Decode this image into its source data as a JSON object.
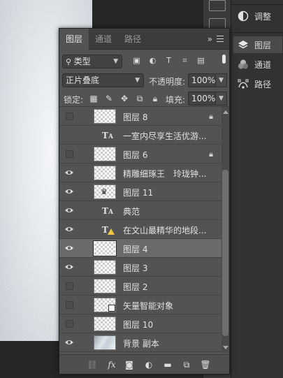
{
  "panel": {
    "tabs": [
      "图层",
      "通道",
      "路径"
    ],
    "more": "»"
  },
  "filter": {
    "kind_label": "类型"
  },
  "blend": {
    "mode": "正片叠底",
    "opacity_label": "不透明度:",
    "opacity_value": "100%"
  },
  "lock": {
    "label": "锁定:",
    "fill_label": "填充:",
    "fill_value": "100%"
  },
  "layers": [
    {
      "name": "图层 8",
      "type": "pixel",
      "visible": false,
      "locked": true,
      "selected": false
    },
    {
      "name": "一室内尽享生活优游...",
      "type": "text",
      "visible": false,
      "locked": false,
      "selected": false
    },
    {
      "name": "图层 6",
      "type": "pixel",
      "visible": false,
      "locked": true,
      "selected": false
    },
    {
      "name": "精雕细琢王　玲珑钟...",
      "type": "pixel",
      "visible": true,
      "locked": false,
      "selected": false
    },
    {
      "name": "图层 11",
      "type": "pixel-mark",
      "visible": true,
      "locked": false,
      "selected": false
    },
    {
      "name": "典范",
      "type": "text",
      "visible": true,
      "locked": false,
      "selected": false
    },
    {
      "name": "在文山最精华的地段...",
      "type": "text-warning",
      "visible": true,
      "locked": false,
      "selected": false
    },
    {
      "name": "图层 4",
      "type": "pixel",
      "visible": true,
      "locked": false,
      "selected": true
    },
    {
      "name": "图层 3",
      "type": "pixel",
      "visible": true,
      "locked": false,
      "selected": false
    },
    {
      "name": "图层 2",
      "type": "pixel",
      "visible": false,
      "locked": false,
      "selected": false
    },
    {
      "name": "矢量智能对象",
      "type": "smart",
      "visible": false,
      "locked": false,
      "selected": false
    },
    {
      "name": "图层 10",
      "type": "pixel",
      "visible": false,
      "locked": false,
      "selected": false
    },
    {
      "name": "背景 副本",
      "type": "background",
      "visible": true,
      "locked": false,
      "selected": false
    }
  ],
  "dock": [
    {
      "label": "调整",
      "icon": "adjustments-icon"
    },
    {
      "label": "图层",
      "icon": "layers-icon"
    },
    {
      "label": "通道",
      "icon": "channels-icon"
    },
    {
      "label": "路径",
      "icon": "paths-icon"
    }
  ],
  "footer_icons": [
    "link-icon",
    "fx-icon",
    "mask-icon",
    "adjustment-layer-icon",
    "group-folder-icon",
    "new-layer-icon",
    "delete-icon"
  ],
  "colors": {
    "panel_bg": "#535353",
    "selected_row": "#6a6a6a",
    "warning": "#f2c744"
  }
}
